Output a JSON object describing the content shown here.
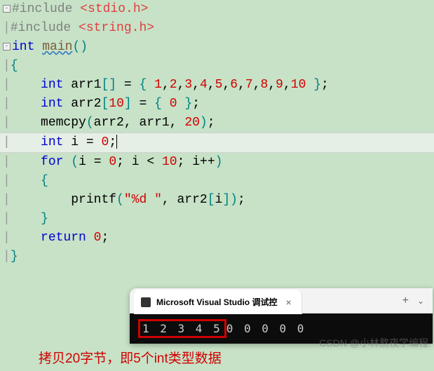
{
  "code": {
    "line1_pre": "#include ",
    "line1_inc": "<stdio.h>",
    "line2_pre": "#include ",
    "line2_inc": "<string.h>",
    "line3_kw": "int",
    "line3_main": "main",
    "line5_kw": "int",
    "line5_id": "arr1",
    "line5_nums": "1, 2, 3, 4, 5, 6, 7, 8, 9, 10",
    "line6_kw": "int",
    "line6_id": "arr2",
    "line6_size": "10",
    "line6_init": "0",
    "line7_fn": "memcpy",
    "line7_a1": "arr2",
    "line7_a2": "arr1",
    "line7_a3": "20",
    "line8_kw": "int",
    "line8_id": "i",
    "line8_val": "0",
    "line9_kw": "for",
    "line9_init_id": "i",
    "line9_init_val": "0",
    "line9_cond_id": "i",
    "line9_cond_val": "10",
    "line9_inc": "i++",
    "line11_fn": "printf",
    "line11_fmt": "\"%d \"",
    "line11_arg": "arr2[i]",
    "line13_kw": "return",
    "line13_val": "0"
  },
  "console": {
    "tab_title": "Microsoft Visual Studio 调试控",
    "output_hl": "1 2 3 4 5",
    "output_rest": "0 0 0 0 0"
  },
  "annotation": "拷贝20字节，即5个int类型数据",
  "watermark": "CSDN @小林熬夜学编程"
}
